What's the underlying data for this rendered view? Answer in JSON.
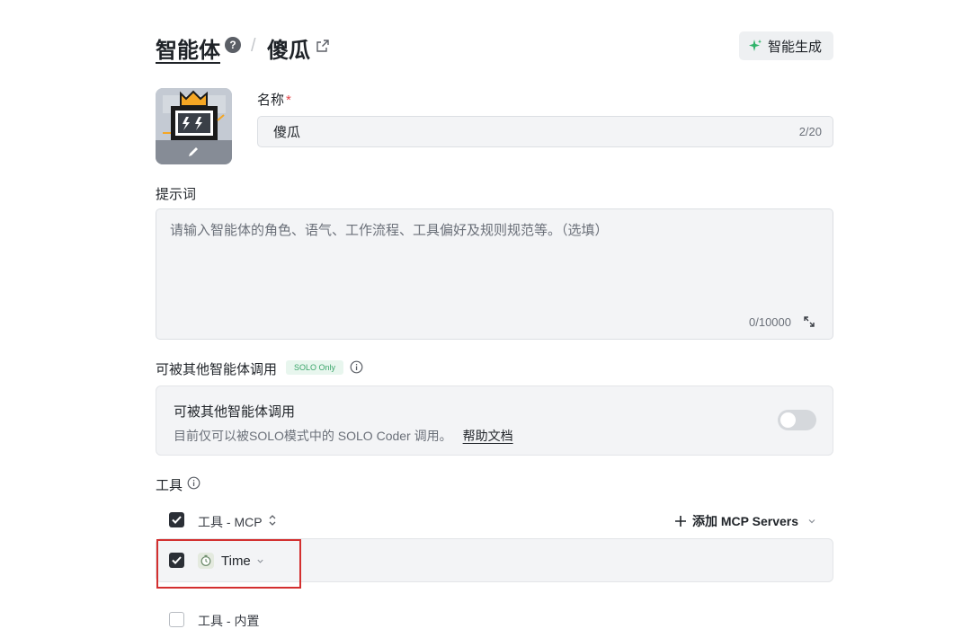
{
  "header": {
    "breadcrumb_root": "智能体",
    "separator": "/",
    "current": "傻瓜",
    "generate_button": "智能生成"
  },
  "name_field": {
    "label": "名称",
    "required_mark": "*",
    "value": "傻瓜",
    "counter": "2/20"
  },
  "prompt_field": {
    "label": "提示词",
    "placeholder": "请输入智能体的角色、语气、工作流程、工具偏好及规则规范等。（选填）",
    "counter": "0/10000"
  },
  "callable": {
    "label": "可被其他智能体调用",
    "badge": "SOLO Only",
    "card_title": "可被其他智能体调用",
    "card_desc": "目前仅可以被SOLO模式中的 SOLO Coder 调用。",
    "help_link": "帮助文档",
    "toggle_on": false
  },
  "tools": {
    "label": "工具",
    "mcp_group": {
      "label": "工具 - MCP",
      "checked": true
    },
    "add_mcp": "添加 MCP Servers",
    "mcp_items": [
      {
        "label": "Time",
        "checked": true
      }
    ],
    "builtin_group": {
      "label": "工具 - 内置",
      "checked": false
    }
  },
  "colors": {
    "accent_green": "#3aa56a",
    "highlight_red": "#d32f2f",
    "checkbox_dark": "#2b2f36"
  }
}
